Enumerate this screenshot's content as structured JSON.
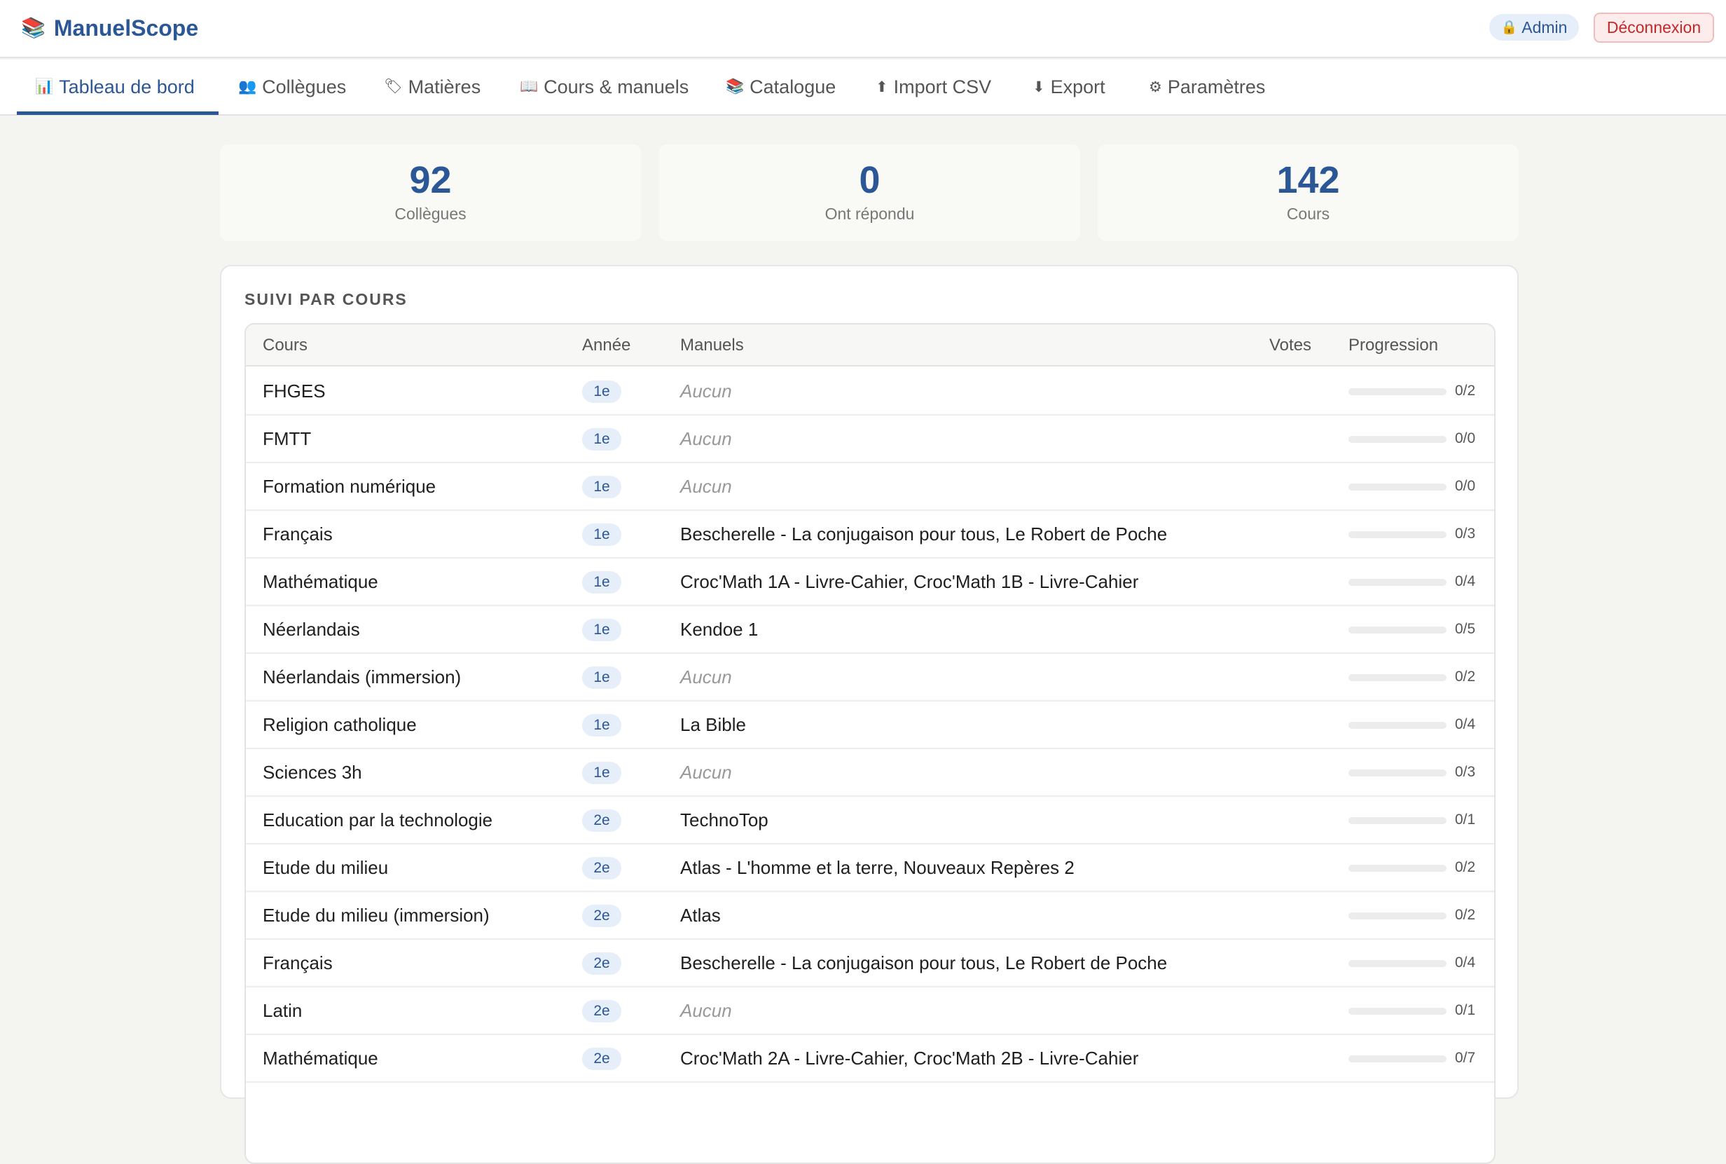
{
  "app": {
    "title": "ManuelScope",
    "logo_icon": "books-icon"
  },
  "header": {
    "admin_label": "Admin",
    "admin_icon": "lock-icon",
    "logout_label": "Déconnexion"
  },
  "nav": {
    "tabs": [
      {
        "label": "Tableau de bord",
        "icon": "📊",
        "icon_name": "chart-icon",
        "active": true
      },
      {
        "label": "Collègues",
        "icon": "👥",
        "icon_name": "people-icon",
        "active": false
      },
      {
        "label": "Matières",
        "icon": "🏷",
        "icon_name": "tag-icon",
        "active": false
      },
      {
        "label": "Cours & manuels",
        "icon": "📖",
        "icon_name": "book-icon",
        "active": false
      },
      {
        "label": "Catalogue",
        "icon": "📚",
        "icon_name": "books-icon",
        "active": false
      },
      {
        "label": "Import CSV",
        "icon": "⬆",
        "icon_name": "upload-icon",
        "active": false
      },
      {
        "label": "Export",
        "icon": "⬇",
        "icon_name": "download-icon",
        "active": false
      },
      {
        "label": "Paramètres",
        "icon": "⚙",
        "icon_name": "gear-icon",
        "active": false
      }
    ]
  },
  "stats": [
    {
      "value": "92",
      "label": "Collègues"
    },
    {
      "value": "0",
      "label": "Ont répondu"
    },
    {
      "value": "142",
      "label": "Cours"
    }
  ],
  "tracking": {
    "title": "SUIVI PAR COURS",
    "columns": {
      "cours": "Cours",
      "annee": "Année",
      "manuels": "Manuels",
      "votes": "Votes",
      "progression": "Progression"
    },
    "rows": [
      {
        "cours": "FHGES",
        "annee": "1e",
        "manuels": "Aucun",
        "none": true,
        "progress": "0/2",
        "fraction": 0
      },
      {
        "cours": "FMTT",
        "annee": "1e",
        "manuels": "Aucun",
        "none": true,
        "progress": "0/0",
        "fraction": 0
      },
      {
        "cours": "Formation numérique",
        "annee": "1e",
        "manuels": "Aucun",
        "none": true,
        "progress": "0/0",
        "fraction": 0
      },
      {
        "cours": "Français",
        "annee": "1e",
        "manuels": "Bescherelle - La conjugaison pour tous, Le Robert de Poche",
        "none": false,
        "progress": "0/3",
        "fraction": 0
      },
      {
        "cours": "Mathématique",
        "annee": "1e",
        "manuels": "Croc'Math 1A - Livre-Cahier, Croc'Math 1B - Livre-Cahier",
        "none": false,
        "progress": "0/4",
        "fraction": 0
      },
      {
        "cours": "Néerlandais",
        "annee": "1e",
        "manuels": "Kendoe 1",
        "none": false,
        "progress": "0/5",
        "fraction": 0
      },
      {
        "cours": "Néerlandais (immersion)",
        "annee": "1e",
        "manuels": "Aucun",
        "none": true,
        "progress": "0/2",
        "fraction": 0
      },
      {
        "cours": "Religion catholique",
        "annee": "1e",
        "manuels": "La Bible",
        "none": false,
        "progress": "0/4",
        "fraction": 0
      },
      {
        "cours": "Sciences 3h",
        "annee": "1e",
        "manuels": "Aucun",
        "none": true,
        "progress": "0/3",
        "fraction": 0
      },
      {
        "cours": "Education par la technologie",
        "annee": "2e",
        "manuels": "TechnoTop",
        "none": false,
        "progress": "0/1",
        "fraction": 0
      },
      {
        "cours": "Etude du milieu",
        "annee": "2e",
        "manuels": "Atlas - L'homme et la terre, Nouveaux Repères 2",
        "none": false,
        "progress": "0/2",
        "fraction": 0
      },
      {
        "cours": "Etude du milieu (immersion)",
        "annee": "2e",
        "manuels": "Atlas",
        "none": false,
        "progress": "0/2",
        "fraction": 0
      },
      {
        "cours": "Français",
        "annee": "2e",
        "manuels": "Bescherelle - La conjugaison pour tous, Le Robert de Poche",
        "none": false,
        "progress": "0/4",
        "fraction": 0
      },
      {
        "cours": "Latin",
        "annee": "2e",
        "manuels": "Aucun",
        "none": true,
        "progress": "0/1",
        "fraction": 0
      },
      {
        "cours": "Mathématique",
        "annee": "2e",
        "manuels": "Croc'Math 2A - Livre-Cahier, Croc'Math 2B - Livre-Cahier",
        "none": false,
        "progress": "0/7",
        "fraction": 0
      }
    ]
  }
}
